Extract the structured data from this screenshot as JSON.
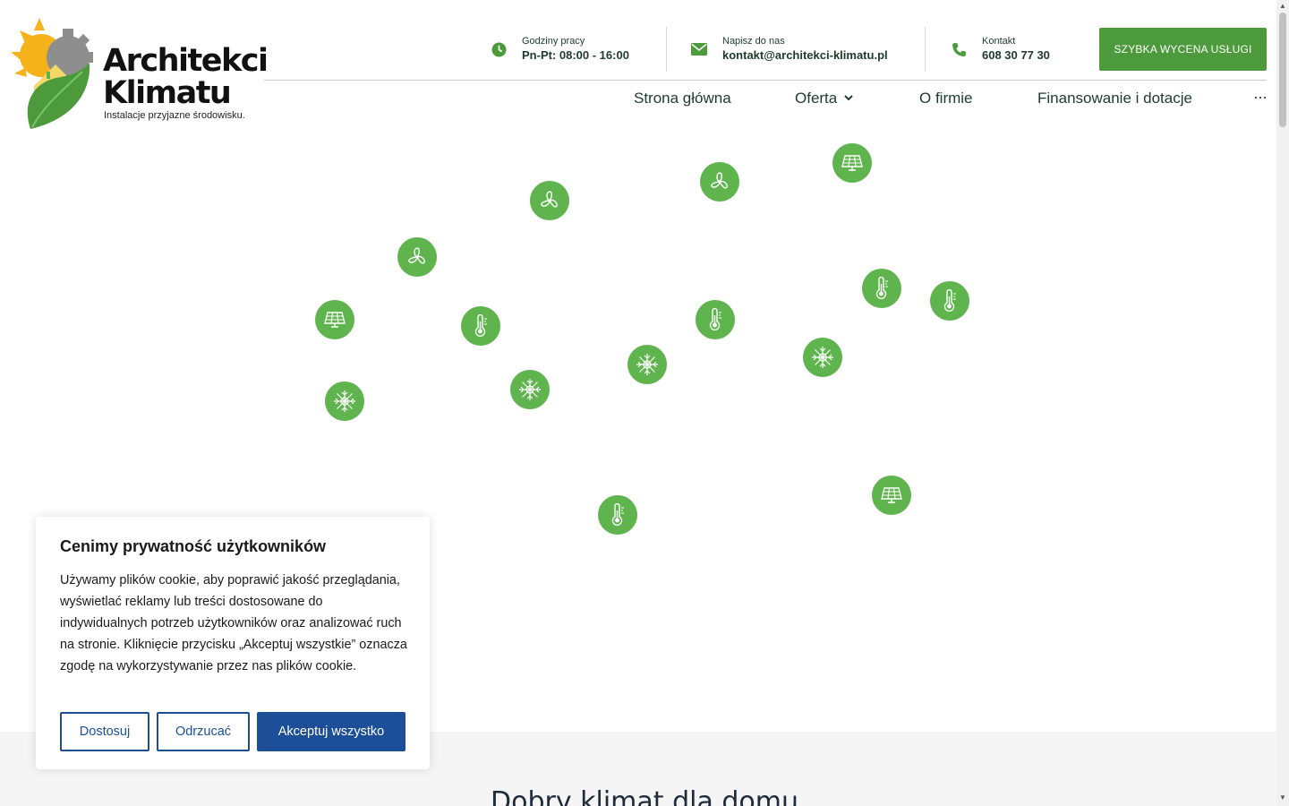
{
  "colors": {
    "brand_green": "#4c9a3c",
    "icon_green": "#5fb44e",
    "accent_blue": "#1c4f97",
    "text_dark": "#1d3b2a"
  },
  "logo": {
    "line1": "Architekci",
    "line2": "Klimatu",
    "tagline": "Instalacje przyjazne środowisku."
  },
  "header": {
    "hours": {
      "icon": "clock-icon",
      "label": "Godziny pracy",
      "value": "Pn-Pt: 08:00 - 16:00"
    },
    "email": {
      "icon": "envelope-icon",
      "label": "Napisz do nas",
      "value": "kontakt@architekci-klimatu.pl"
    },
    "phone": {
      "icon": "phone-icon",
      "label": "Kontakt",
      "value": "608 30 77 30"
    },
    "cta_label": "SZYBKA WYCENA USŁUGI"
  },
  "nav": {
    "items": [
      {
        "label": "Strona główna"
      },
      {
        "label": "Oferta"
      },
      {
        "label": "O firmie"
      },
      {
        "label": "Finansowanie i dotacje"
      }
    ],
    "more": "···"
  },
  "floating_icons": [
    {
      "icon": "solar-panel-icon"
    },
    {
      "icon": "fan-icon"
    },
    {
      "icon": "fan-icon"
    },
    {
      "icon": "fan-icon"
    },
    {
      "icon": "solar-panel-icon"
    },
    {
      "icon": "thermometer-icon"
    },
    {
      "icon": "thermometer-icon"
    },
    {
      "icon": "thermometer-icon"
    },
    {
      "icon": "thermometer-icon"
    },
    {
      "icon": "snowflake-icon"
    },
    {
      "icon": "snowflake-icon"
    },
    {
      "icon": "snowflake-icon"
    },
    {
      "icon": "snowflake-icon"
    },
    {
      "icon": "solar-panel-icon"
    },
    {
      "icon": "thermometer-icon"
    }
  ],
  "section": {
    "title": "Dobry klimat dla domu"
  },
  "cookie": {
    "title": "Cenimy prywatność użytkowników",
    "text": "Używamy plików cookie, aby poprawić jakość przeglądania, wyświetlać reklamy lub treści dostosowane do indywidualnych potrzeb użytkowników oraz analizować ruch na stronie. Kliknięcie przycisku „Akceptuj wszystkie” oznacza zgodę na wykorzystywanie przez nas plików cookie.",
    "customize_label": "Dostosuj",
    "reject_label": "Odrzucać",
    "accept_label": "Akceptuj wszystko"
  }
}
